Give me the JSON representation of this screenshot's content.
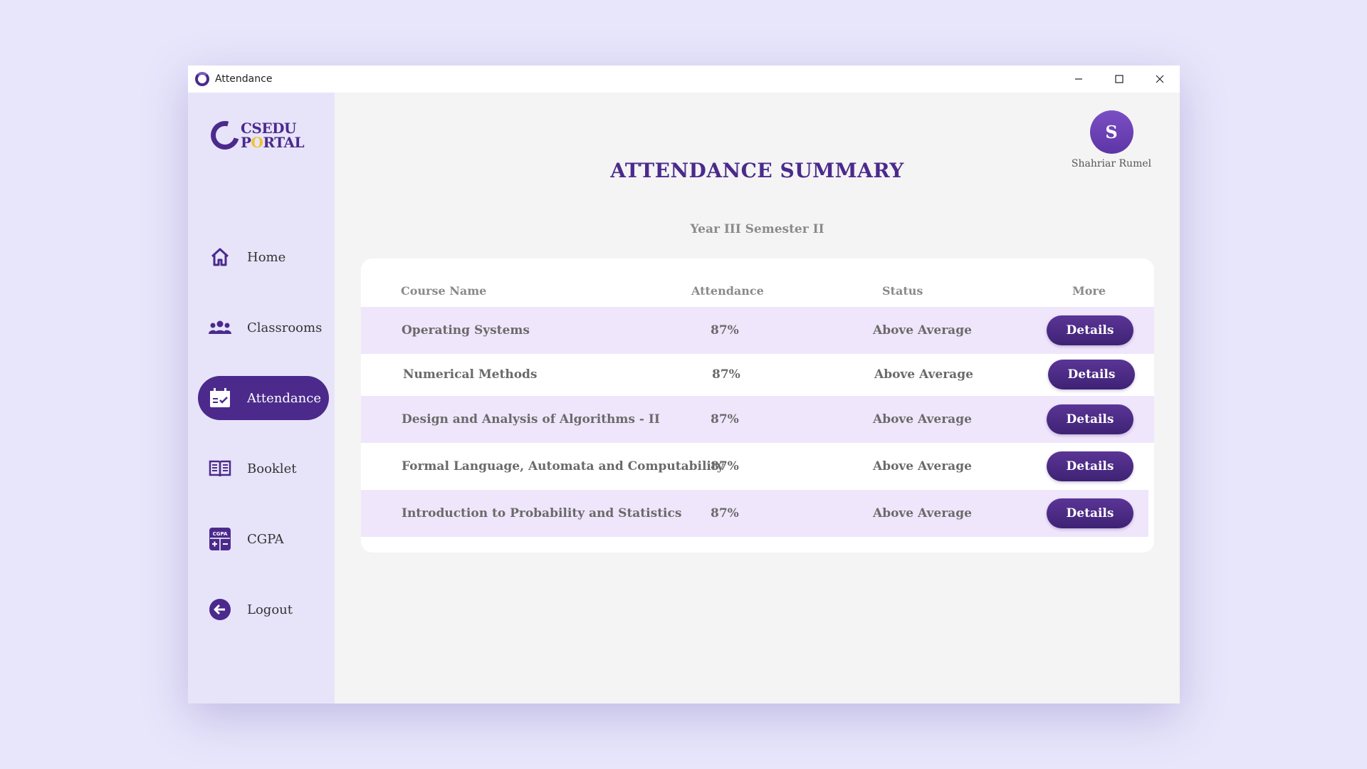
{
  "window": {
    "title": "Attendance",
    "controls": [
      "minimize",
      "maximize",
      "close"
    ]
  },
  "logo": {
    "line1": "CSEDU",
    "line2_a": "P",
    "line2_b": "O",
    "line2_c": "RTAL"
  },
  "sidebar": {
    "items": [
      {
        "label": "Home",
        "icon": "home-icon"
      },
      {
        "label": "Classrooms",
        "icon": "people-icon"
      },
      {
        "label": "Attendance",
        "icon": "calendar-check-icon",
        "active": true
      },
      {
        "label": "Booklet",
        "icon": "book-icon"
      },
      {
        "label": "CGPA",
        "icon": "calculator-icon"
      },
      {
        "label": "Logout",
        "icon": "logout-icon"
      }
    ]
  },
  "user": {
    "initial": "S",
    "name": "Shahriar Rumel"
  },
  "main": {
    "title": "ATTENDANCE SUMMARY",
    "semester": "Year III Semester II"
  },
  "table": {
    "headers": {
      "course": "Course Name",
      "attendance": "Attendance",
      "status": "Status",
      "more": "More"
    },
    "rows": [
      {
        "course": "Operating Systems",
        "attendance": "87%",
        "status": "Above Average",
        "action": "Details"
      },
      {
        "course": "Numerical Methods",
        "attendance": "87%",
        "status": "Above Average",
        "action": "Details"
      },
      {
        "course": "Design and Analysis of Algorithms - II",
        "attendance": "87%",
        "status": "Above Average",
        "action": "Details"
      },
      {
        "course": "Formal Language, Automata and Computability",
        "attendance": "87%",
        "status": "Above Average",
        "action": "Details"
      },
      {
        "course": "Introduction to Probability and Statistics",
        "attendance": "87%",
        "status": "Above Average",
        "action": "Details"
      }
    ]
  },
  "colors": {
    "accent": "#4b2a8c",
    "sidebar_bg": "#e7e4fa",
    "row_shade": "#efe6fb"
  }
}
